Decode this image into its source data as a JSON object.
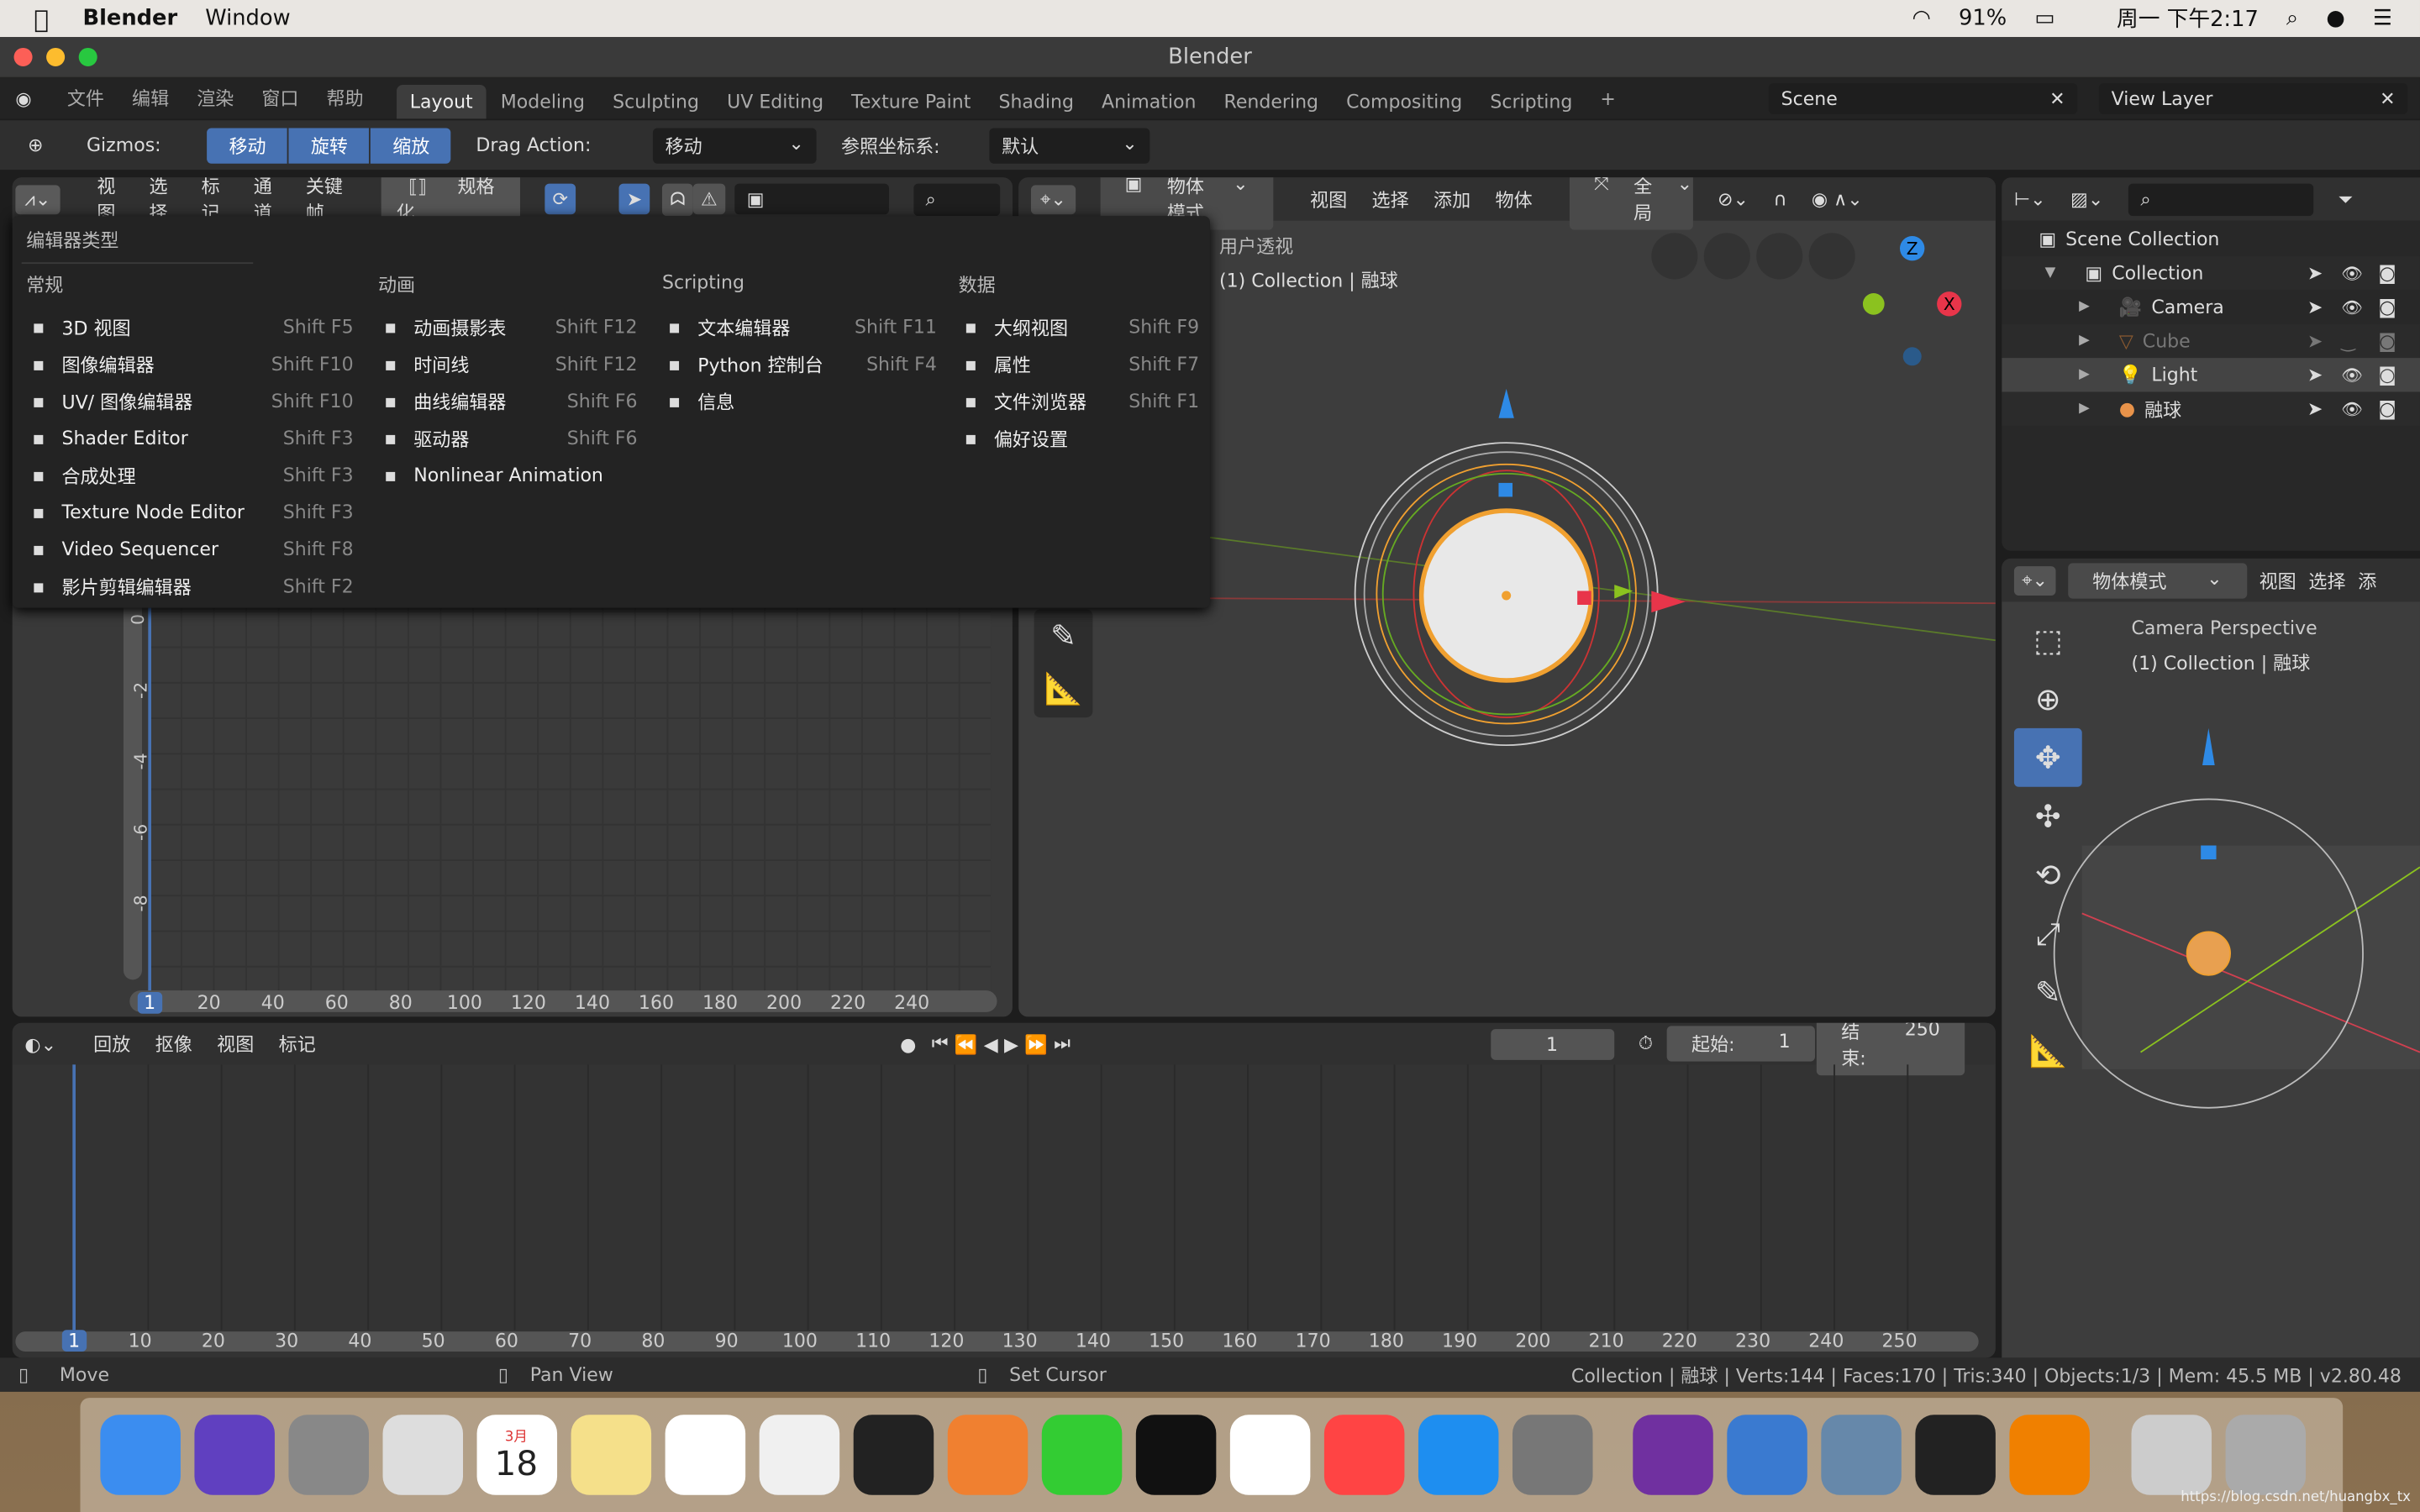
{
  "menubar": {
    "app": "Blender",
    "items": [
      "Window"
    ],
    "battery": "91%",
    "clock": "周一 下午2:17"
  },
  "window": {
    "title": "Blender"
  },
  "topbar": {
    "menus": [
      "文件",
      "编辑",
      "渲染",
      "窗口",
      "帮助"
    ],
    "tabs": [
      "Layout",
      "Modeling",
      "Sculpting",
      "UV Editing",
      "Texture Paint",
      "Shading",
      "Animation",
      "Rendering",
      "Compositing",
      "Scripting"
    ],
    "active_tab": "Layout",
    "add_tab": "+",
    "scene": "Scene",
    "view_layer": "View Layer"
  },
  "toolheader": {
    "gizmos_label": "Gizmos:",
    "gizmo_buttons": [
      "移动",
      "旋转",
      "缩放"
    ],
    "drag_label": "Drag Action:",
    "drag_value": "移动",
    "orient_label": "参照坐标系:",
    "orient_value": "默认"
  },
  "graph_editor": {
    "menus": [
      "视图",
      "选择",
      "标记",
      "通道",
      "关键帧"
    ],
    "normalize": "规格化",
    "x_ticks": [
      "1",
      "20",
      "40",
      "60",
      "80",
      "100",
      "120",
      "140",
      "160",
      "180",
      "200",
      "220",
      "240"
    ],
    "y_ticks": [
      "0",
      "-2",
      "-4",
      "-6",
      "-8"
    ]
  },
  "editor_type_menu": {
    "title": "编辑器类型",
    "columns": [
      {
        "title": "常规",
        "items": [
          {
            "label": "3D 视图",
            "shortcut": "Shift F5",
            "icon": "3d-view-icon"
          },
          {
            "label": "图像编辑器",
            "shortcut": "Shift F10",
            "icon": "image-editor-icon"
          },
          {
            "label": "UV/ 图像编辑器",
            "shortcut": "Shift F10",
            "icon": "uv-editor-icon"
          },
          {
            "label": "Shader Editor",
            "shortcut": "Shift F3",
            "icon": "shader-editor-icon"
          },
          {
            "label": "合成处理",
            "shortcut": "Shift F3",
            "icon": "compositor-icon"
          },
          {
            "label": "Texture Node Editor",
            "shortcut": "Shift F3",
            "icon": "texture-node-icon"
          },
          {
            "label": "Video Sequencer",
            "shortcut": "Shift F8",
            "icon": "sequencer-icon"
          },
          {
            "label": "影片剪辑编辑器",
            "shortcut": "Shift F2",
            "icon": "clip-editor-icon"
          }
        ]
      },
      {
        "title": "动画",
        "items": [
          {
            "label": "动画摄影表",
            "shortcut": "Shift F12",
            "icon": "dopesheet-icon"
          },
          {
            "label": "时间线",
            "shortcut": "Shift F12",
            "icon": "timeline-icon"
          },
          {
            "label": "曲线编辑器",
            "shortcut": "Shift F6",
            "icon": "graph-editor-icon"
          },
          {
            "label": "驱动器",
            "shortcut": "Shift F6",
            "icon": "drivers-icon"
          },
          {
            "label": "Nonlinear Animation",
            "shortcut": "",
            "icon": "nla-icon"
          }
        ]
      },
      {
        "title": "Scripting",
        "items": [
          {
            "label": "文本编辑器",
            "shortcut": "Shift F11",
            "icon": "text-editor-icon"
          },
          {
            "label": "Python 控制台",
            "shortcut": "Shift F4",
            "icon": "console-icon"
          },
          {
            "label": "信息",
            "shortcut": "",
            "icon": "info-icon"
          }
        ]
      },
      {
        "title": "数据",
        "items": [
          {
            "label": "大纲视图",
            "shortcut": "Shift F9",
            "icon": "outliner-icon"
          },
          {
            "label": "属性",
            "shortcut": "Shift F7",
            "icon": "properties-icon"
          },
          {
            "label": "文件浏览器",
            "shortcut": "Shift F1",
            "icon": "file-browser-icon"
          },
          {
            "label": "偏好设置",
            "shortcut": "",
            "icon": "preferences-icon"
          }
        ]
      }
    ]
  },
  "viewport": {
    "mode": "物体模式",
    "menus": [
      "视图",
      "选择",
      "添加",
      "物体"
    ],
    "orientation": "全局",
    "overlay_text1": "用户透视",
    "overlay_text2": "(1) Collection | 融球",
    "axes": {
      "x": "X",
      "z": "Z"
    },
    "colors": {
      "x": "#e8354a",
      "y": "#8bc21f",
      "z": "#2e8ae6",
      "select": "#f0a030"
    }
  },
  "outliner": {
    "rows": [
      {
        "label": "Scene Collection",
        "level": 0
      },
      {
        "label": "Collection",
        "level": 1
      },
      {
        "label": "Camera",
        "level": 2
      },
      {
        "label": "Cube",
        "level": 2,
        "hidden": true
      },
      {
        "label": "Light",
        "level": 2
      },
      {
        "label": "融球",
        "level": 2
      }
    ]
  },
  "camera_view": {
    "mode": "物体模式",
    "menus": [
      "视图",
      "选择",
      "添"
    ],
    "text1": "Camera Perspective",
    "text2": "(1) Collection | 融球"
  },
  "timeline": {
    "menus": [
      "回放",
      "抠像",
      "视图",
      "标记"
    ],
    "current_frame": "1",
    "start_label": "起始:",
    "start": "1",
    "end_label": "结束:",
    "end": "250",
    "ticks": [
      "1",
      "10",
      "20",
      "30",
      "40",
      "50",
      "60",
      "70",
      "80",
      "90",
      "100",
      "110",
      "120",
      "130",
      "140",
      "150",
      "160",
      "170",
      "180",
      "190",
      "200",
      "210",
      "220",
      "230",
      "240",
      "250"
    ]
  },
  "statusbar": {
    "left": "Move",
    "middle": "Pan View",
    "right": "Set Cursor",
    "stats": "Collection | 融球 | Verts:144 | Faces:170 | Tris:340 | Objects:1/3 | Mem: 45.5 MB | v2.80.48"
  },
  "dock": {
    "apps": [
      "Finder",
      "Siri",
      "Launchpad",
      "Mail",
      "Calendar",
      "Notes",
      "Reminders",
      "Photos",
      "Vectorize",
      "Pages",
      "WeChat",
      "QQ",
      "Chrome",
      "iTunes",
      "App Store",
      "System Preferences",
      "OneNote",
      "Preview",
      "Image Capture",
      "Terminal",
      "Blender",
      "Downloads",
      "Trash"
    ],
    "calendar_day": "18",
    "calendar_month": "3月"
  },
  "watermark": "https://blog.csdn.net/huangbx_tx"
}
